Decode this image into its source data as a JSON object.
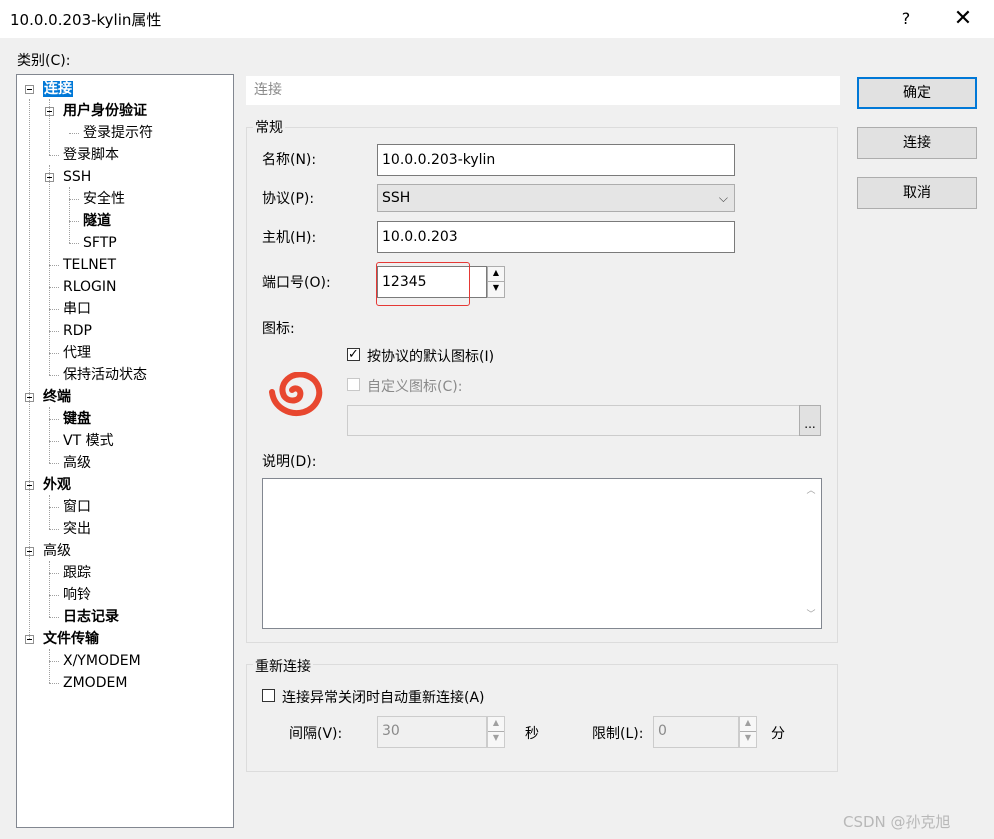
{
  "window": {
    "title": "10.0.0.203-kylin属性",
    "help": "?",
    "close": "✕"
  },
  "category_label": "类别(C):",
  "tree": [
    {
      "label": "连接",
      "bold": true,
      "selected": true
    },
    {
      "label": "用户身份验证",
      "bold": true
    },
    {
      "label": "登录提示符"
    },
    {
      "label": "登录脚本"
    },
    {
      "label": "SSH"
    },
    {
      "label": "安全性"
    },
    {
      "label": "隧道",
      "bold": true
    },
    {
      "label": "SFTP"
    },
    {
      "label": "TELNET"
    },
    {
      "label": "RLOGIN"
    },
    {
      "label": "串口"
    },
    {
      "label": "RDP"
    },
    {
      "label": "代理"
    },
    {
      "label": "保持活动状态"
    },
    {
      "label": "终端",
      "bold": true
    },
    {
      "label": "键盘",
      "bold": true
    },
    {
      "label": "VT 模式"
    },
    {
      "label": "高级"
    },
    {
      "label": "外观",
      "bold": true
    },
    {
      "label": "窗口"
    },
    {
      "label": "突出"
    },
    {
      "label": "高级"
    },
    {
      "label": "跟踪"
    },
    {
      "label": "响铃"
    },
    {
      "label": "日志记录",
      "bold": true
    },
    {
      "label": "文件传输",
      "bold": true
    },
    {
      "label": "X/YMODEM"
    },
    {
      "label": "ZMODEM"
    }
  ],
  "section_header": "连接",
  "general": {
    "title": "常规",
    "name_label": "名称(N):",
    "name_value": "10.0.0.203-kylin",
    "protocol_label": "协议(P):",
    "protocol_value": "SSH",
    "host_label": "主机(H):",
    "host_value": "10.0.0.203",
    "port_label": "端口号(O):",
    "port_value": "12345",
    "icon_label": "图标:",
    "default_icon_label": "按协议的默认图标(I)",
    "default_icon_checked": true,
    "custom_icon_label": "自定义图标(C):",
    "custom_icon_checked": false,
    "browse_label": "...",
    "desc_label": "说明(D):",
    "desc_value": ""
  },
  "reconnect": {
    "title": "重新连接",
    "auto_label": "连接异常关闭时自动重新连接(A)",
    "auto_checked": false,
    "interval_label": "间隔(V):",
    "interval_value": "30",
    "interval_unit": "秒",
    "limit_label": "限制(L):",
    "limit_value": "0",
    "limit_unit": "分"
  },
  "buttons": {
    "ok": "确定",
    "connect": "连接",
    "cancel": "取消"
  },
  "watermark": "CSDN @孙克旭",
  "colors": {
    "selection": "#0078d7",
    "highlight_box": "#e53935",
    "icon": "#e8472f"
  }
}
